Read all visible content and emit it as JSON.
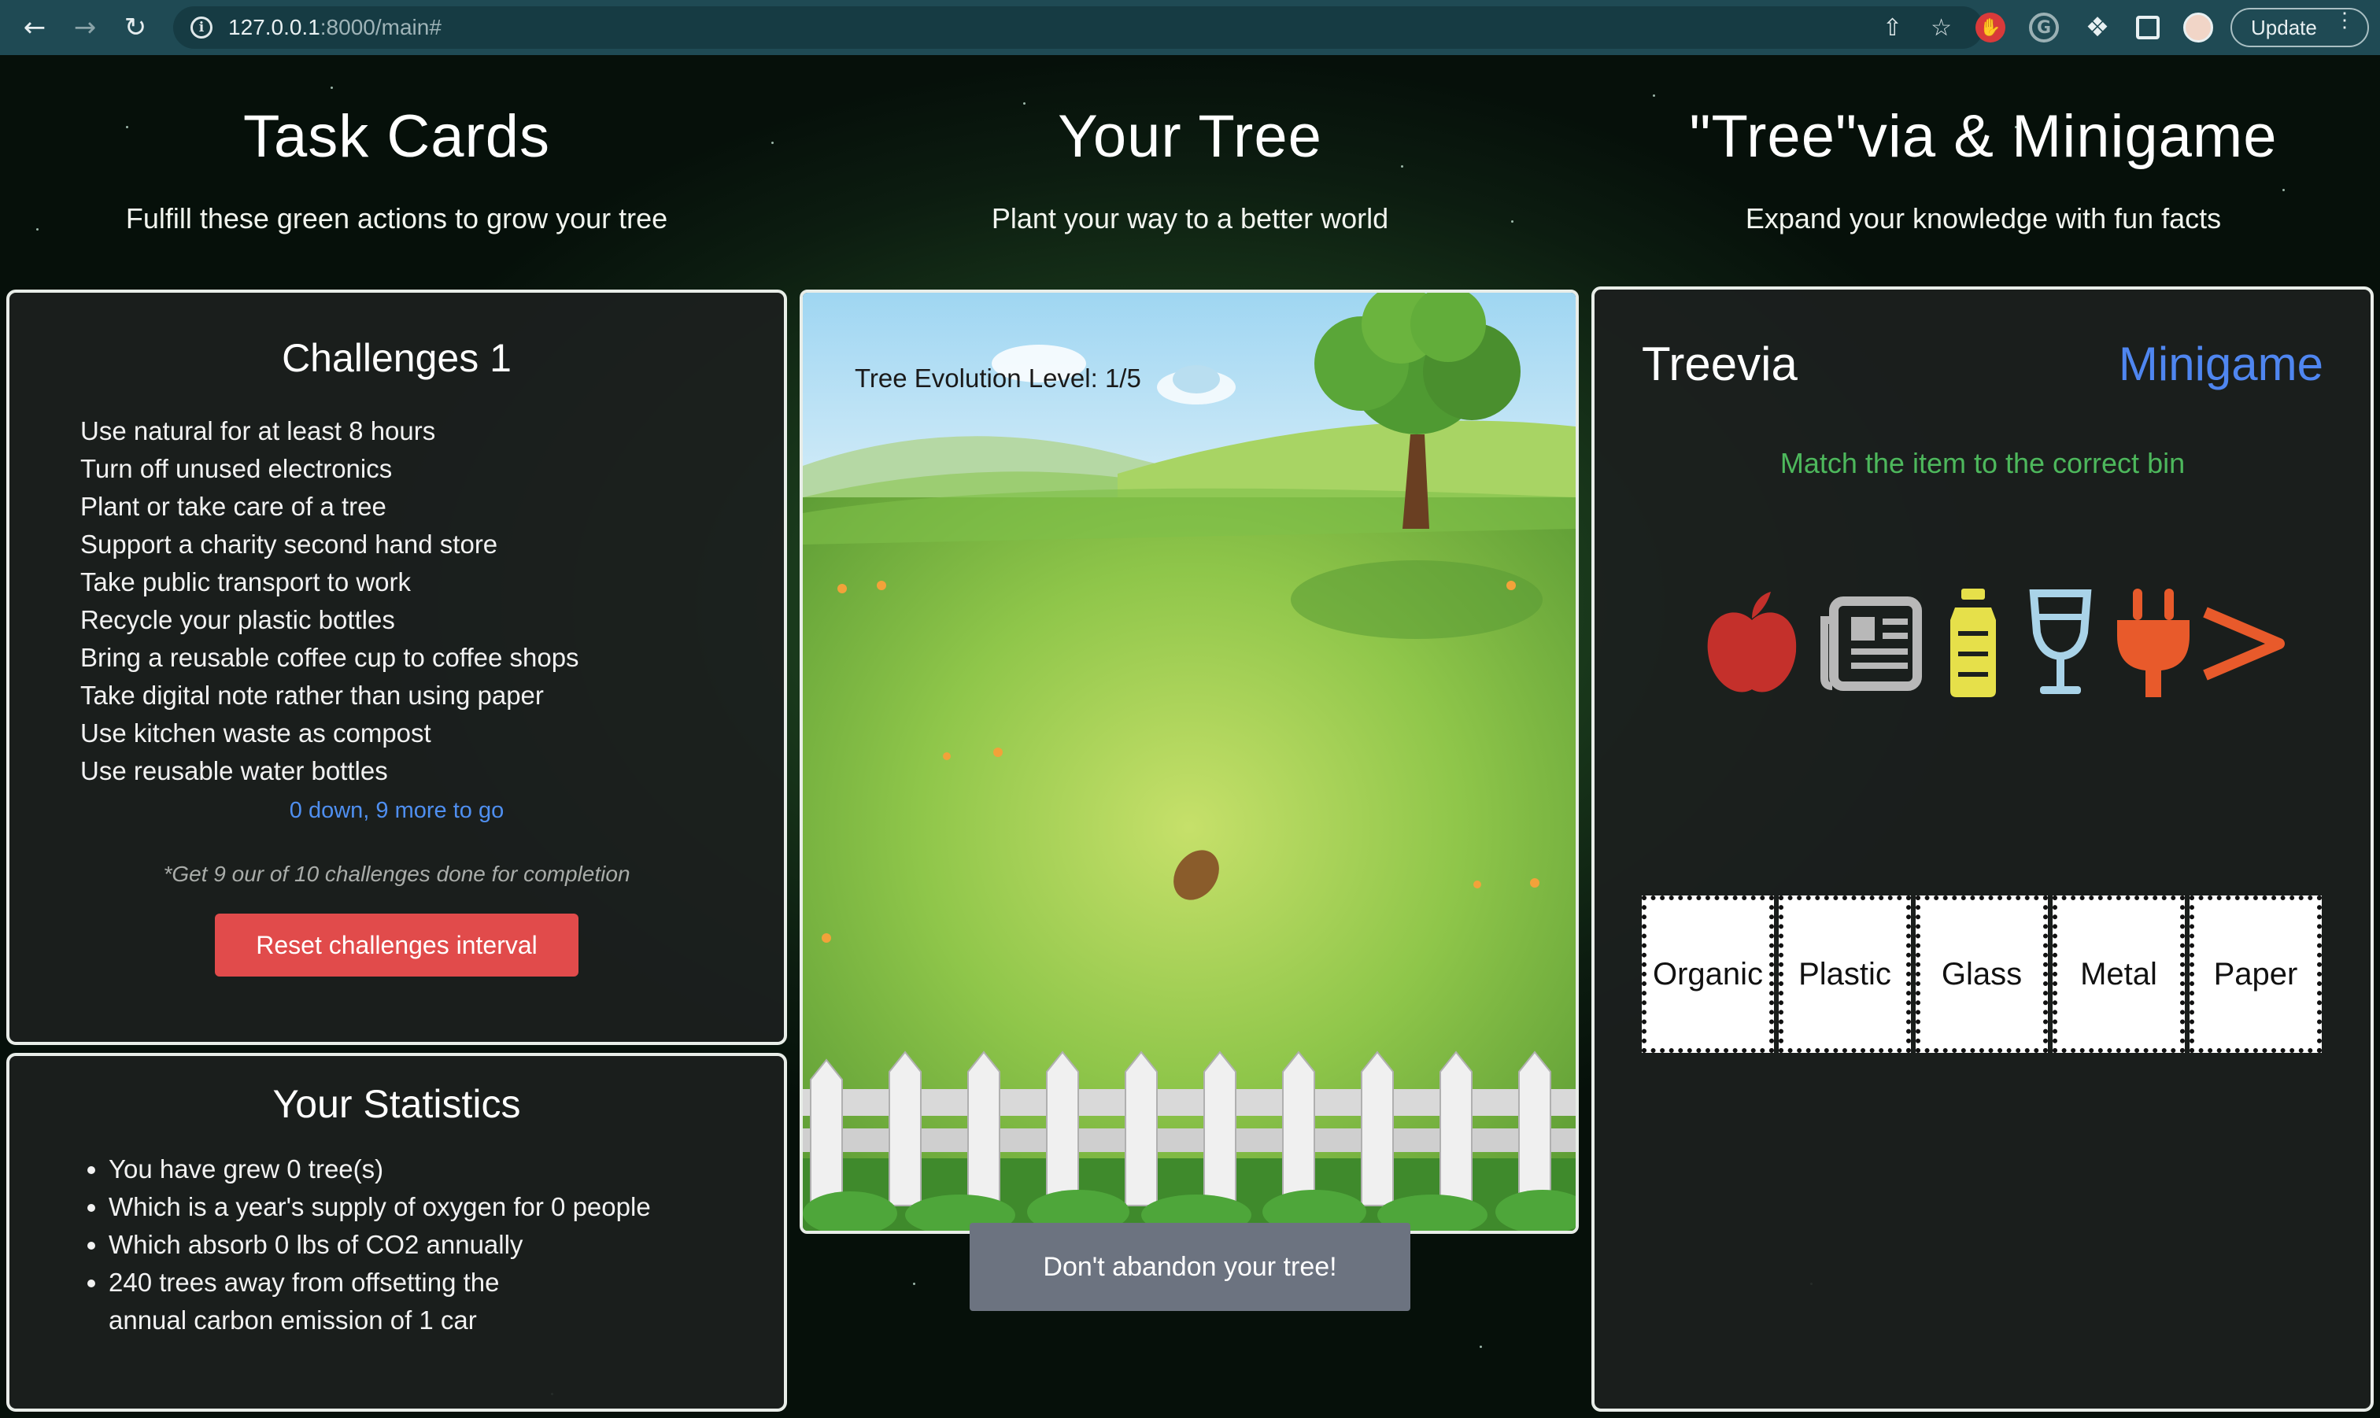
{
  "browser": {
    "url_host": "127.0.0.1",
    "url_path": ":8000/main#",
    "update_label": "Update"
  },
  "columns": {
    "tasks": {
      "title": "Task Cards",
      "subtitle": "Fulfill these green actions to grow your tree"
    },
    "tree": {
      "title": "Your Tree",
      "subtitle": "Plant your way to a better world"
    },
    "treevia": {
      "title": "\"Tree\"via & Minigame",
      "subtitle": "Expand your knowledge with fun facts"
    }
  },
  "challenges": {
    "title": "Challenges 1",
    "items": [
      "Use natural for at least 8 hours",
      "Turn off unused electronics",
      "Plant or take care of a tree",
      "Support a charity second hand store",
      "Take public transport to work",
      "Recycle your plastic bottles",
      "Bring a reusable coffee cup to coffee shops",
      "Take digital note rather than using paper",
      "Use kitchen waste as compost",
      "Use reusable water bottles"
    ],
    "progress": "0 down, 9 more to go",
    "note": "*Get 9 our of 10 challenges done for completion",
    "reset_label": "Reset challenges interval"
  },
  "statistics": {
    "title": "Your Statistics",
    "items": [
      "You have grew 0 tree(s)",
      "Which is a year's supply of oxygen for 0 people",
      "Which absorb 0 lbs of CO2 annually",
      "240 trees away from offsetting the",
      "annual carbon emission of 1 car"
    ]
  },
  "tree": {
    "level_label": "Tree Evolution Level: 1/5",
    "abandon_label": "Don't abandon your tree!"
  },
  "treevia": {
    "tab_treevia": "Treevia",
    "tab_minigame": "Minigame",
    "instruction": "Match the item to the correct bin",
    "items": [
      "apple-icon",
      "newspaper-icon",
      "bottle-icon",
      "wine-glass-icon",
      "plug-icon",
      "arrow-right-icon"
    ],
    "bins": [
      "Organic",
      "Plastic",
      "Glass",
      "Metal",
      "Paper"
    ]
  },
  "colors": {
    "accent_blue": "#4f86f0",
    "danger_red": "#e14b4b",
    "instruction_green": "#4db85c"
  }
}
